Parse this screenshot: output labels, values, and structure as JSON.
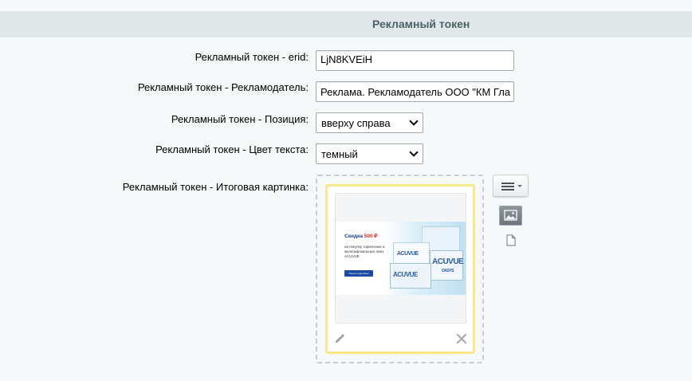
{
  "section": {
    "title": "Рекламный токен"
  },
  "fields": {
    "erid": {
      "label": "Рекламный токен - erid:",
      "value": "LjN8KVEiH"
    },
    "advertiser": {
      "label": "Рекламный токен - Рекламодатель:",
      "value": "Реклама. Рекламодатель ООО \"КМ Гла"
    },
    "position": {
      "label": "Рекламный токен - Позиция:",
      "selected": "вверху справа"
    },
    "text_color": {
      "label": "Рекламный токен - Цвет текста:",
      "selected": "темный"
    },
    "final_image": {
      "label": "Рекламный токен - Итоговая картинка:"
    }
  },
  "banner": {
    "discount_word": "Скидка",
    "price": "500 ₽",
    "subtitle": "на покупку торических и мультифокальных линз ACUVUE",
    "button": "Узнать подробнее",
    "brand": "ACUVUE",
    "brand_sub": "OASYS"
  },
  "icons": {
    "edit": "pencil-icon",
    "remove": "close-icon",
    "menu": "hamburger-menu-icon",
    "image": "image-icon",
    "file": "file-icon"
  },
  "colors": {
    "header_bg": "#e0e8ea",
    "header_text": "#4b6267",
    "frame_highlight": "#f9e88a",
    "page_bg": "#f5f9f9"
  }
}
